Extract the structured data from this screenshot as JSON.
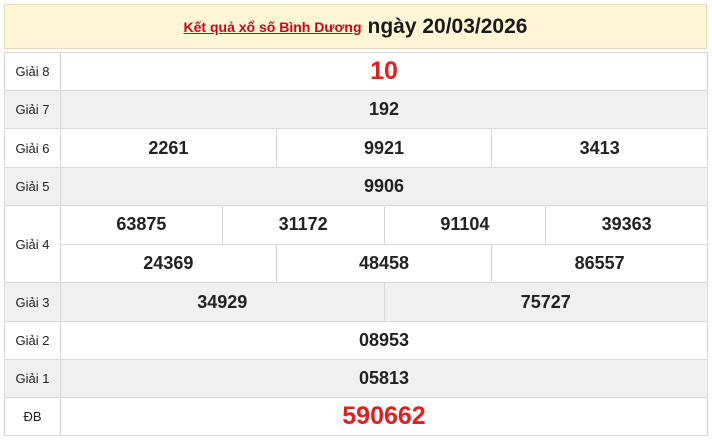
{
  "header": {
    "link_text": "Kết quả xổ số Bình Dương",
    "date_text": "ngày 20/03/2026"
  },
  "prizes": {
    "g8": {
      "label": "Giải 8",
      "values": [
        "10"
      ]
    },
    "g7": {
      "label": "Giải 7",
      "values": [
        "192"
      ]
    },
    "g6": {
      "label": "Giải 6",
      "values": [
        "2261",
        "9921",
        "3413"
      ]
    },
    "g5": {
      "label": "Giải 5",
      "values": [
        "9906"
      ]
    },
    "g4": {
      "label": "Giải 4",
      "row1": [
        "63875",
        "31172",
        "91104",
        "39363"
      ],
      "row2": [
        "24369",
        "48458",
        "86557"
      ]
    },
    "g3": {
      "label": "Giải 3",
      "values": [
        "34929",
        "75727"
      ]
    },
    "g2": {
      "label": "Giải 2",
      "values": [
        "08953"
      ]
    },
    "g1": {
      "label": "Giải 1",
      "values": [
        "05813"
      ]
    },
    "db": {
      "label": "ĐB",
      "values": [
        "590662"
      ]
    }
  },
  "colors": {
    "accent": "#e02020",
    "header_bg": "#fff6d6",
    "link": "#d0021b"
  }
}
